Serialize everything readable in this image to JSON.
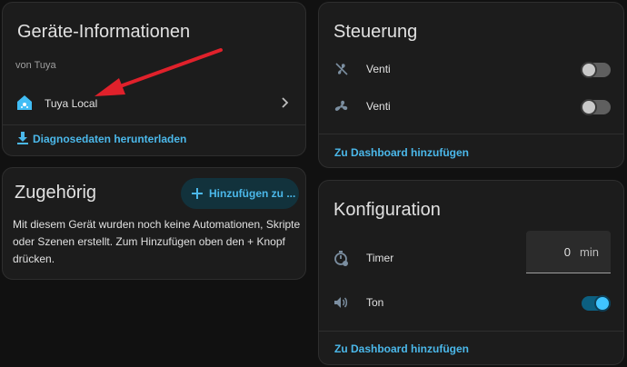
{
  "device_info": {
    "title": "Geräte-Informationen",
    "manufacturer": "von Tuya",
    "integration": "Tuya Local",
    "download_link": "Diagnosedaten herunterladen",
    "icons": {
      "integration": "home-assistant-icon",
      "chevron": "chevron-right-icon",
      "download": "download-icon",
      "annotation": "red-arrow"
    }
  },
  "related": {
    "title": "Zugehörig",
    "add_button": "Hinzufügen zu ...",
    "description": "Mit diesem Gerät wurden noch keine Automationen, Skripte oder Szenen erstellt. Zum Hinzufügen oben den + Knopf drücken."
  },
  "controls": {
    "title": "Steuerung",
    "rows": [
      {
        "label": "Venti",
        "icon": "fan-off-icon",
        "state": "off"
      },
      {
        "label": "Venti",
        "icon": "fan-icon",
        "state": "off"
      }
    ],
    "dashboard_link": "Zu Dashboard hinzufügen"
  },
  "configuration": {
    "title": "Konfiguration",
    "timer": {
      "label": "Timer",
      "value": "0",
      "unit": "min",
      "icon": "timer-icon"
    },
    "tone": {
      "label": "Ton",
      "icon": "volume-icon",
      "state": "on"
    },
    "dashboard_link": "Zu Dashboard hinzufügen"
  },
  "colors": {
    "accent": "#4bb8ea",
    "background": "#111111",
    "card": "#1c1c1c",
    "annotation": "#e0212b"
  }
}
